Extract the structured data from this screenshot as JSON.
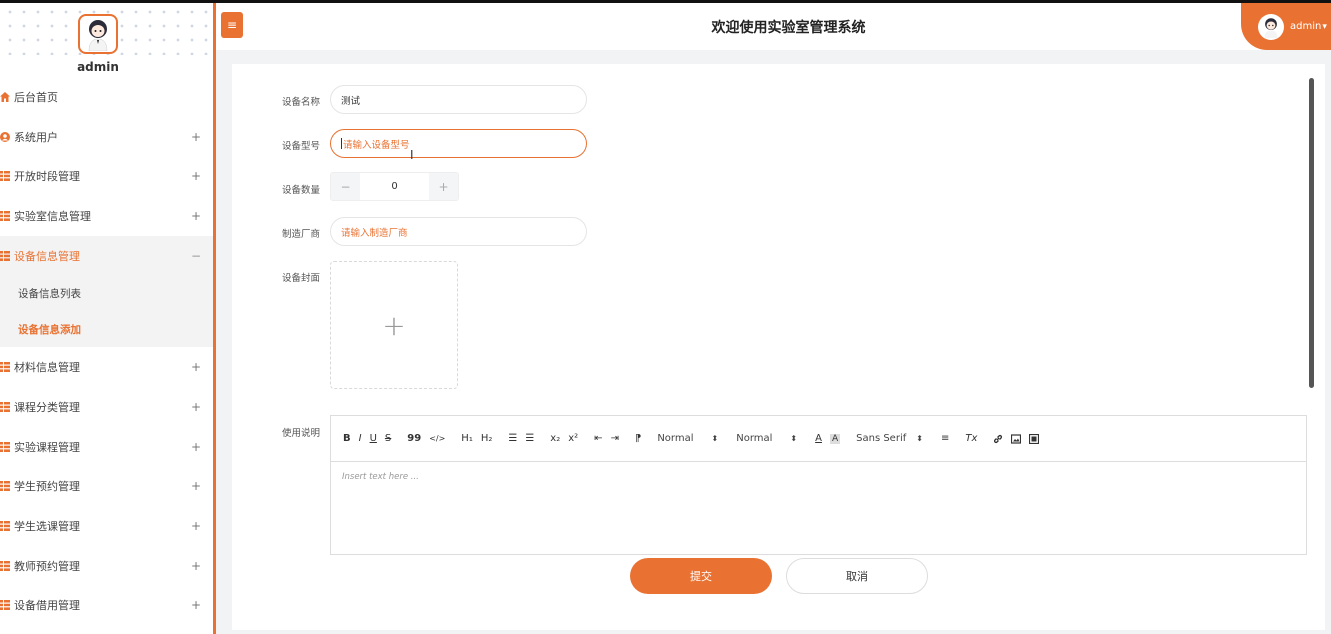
{
  "app": {
    "title": "欢迎使用实验室管理系统"
  },
  "colors": {
    "accent": "#e97232"
  },
  "sidebar": {
    "username": "admin",
    "items": [
      {
        "label": "后台首页",
        "icon": "home-icon",
        "expandable": false
      },
      {
        "label": "系统用户",
        "icon": "user-icon",
        "expandable": true,
        "toggle": "+"
      },
      {
        "label": "开放时段管理",
        "icon": "grid-icon",
        "expandable": true,
        "toggle": "+"
      },
      {
        "label": "实验室信息管理",
        "icon": "grid-icon",
        "expandable": true,
        "toggle": "+"
      },
      {
        "label": "设备信息管理",
        "icon": "grid-icon",
        "expandable": true,
        "toggle": "−",
        "active": true,
        "children": [
          {
            "label": "设备信息列表"
          },
          {
            "label": "设备信息添加",
            "active": true
          }
        ]
      },
      {
        "label": "材料信息管理",
        "icon": "grid-icon",
        "expandable": true,
        "toggle": "+"
      },
      {
        "label": "课程分类管理",
        "icon": "grid-icon",
        "expandable": true,
        "toggle": "+"
      },
      {
        "label": "实验课程管理",
        "icon": "grid-icon",
        "expandable": true,
        "toggle": "+"
      },
      {
        "label": "学生预约管理",
        "icon": "grid-icon",
        "expandable": true,
        "toggle": "+"
      },
      {
        "label": "学生选课管理",
        "icon": "grid-icon",
        "expandable": true,
        "toggle": "+"
      },
      {
        "label": "教师预约管理",
        "icon": "grid-icon",
        "expandable": true,
        "toggle": "+"
      },
      {
        "label": "设备借用管理",
        "icon": "grid-icon",
        "expandable": true,
        "toggle": "+"
      }
    ]
  },
  "header": {
    "menu_icon": "menu-icon",
    "user_label": "admin",
    "user_caret": "▾"
  },
  "form": {
    "name": {
      "label": "设备名称",
      "value": "测试"
    },
    "model": {
      "label": "设备型号",
      "value": "",
      "placeholder": "请输入设备型号"
    },
    "quantity": {
      "label": "设备数量",
      "value": "0",
      "minus": "−",
      "plus": "+"
    },
    "manufacturer": {
      "label": "制造厂商",
      "value": "",
      "placeholder": "请输入制造厂商"
    },
    "cover": {
      "label": "设备封面",
      "upload_icon": "+"
    },
    "description": {
      "label": "使用说明",
      "placeholder": "Insert text here ...",
      "toolbar": {
        "bold": "B",
        "italic": "I",
        "underline": "U",
        "strike": "S",
        "quote": "99",
        "code": "</>",
        "h1": "H₁",
        "h2": "H₂",
        "ordered_list": "☰",
        "bullet_list": "☰",
        "subscript": "x₂",
        "superscript": "x²",
        "outdent": "⇤",
        "indent": "⇥",
        "direction": "⁋",
        "size_select": "Normal",
        "header_select": "Normal",
        "color": "A",
        "background": "A",
        "font_select": "Sans Serif",
        "align": "≡",
        "clean": "Tx",
        "link": "🔗",
        "image": "▣",
        "video": "▤"
      }
    }
  },
  "actions": {
    "submit": "提交",
    "cancel": "取消"
  }
}
